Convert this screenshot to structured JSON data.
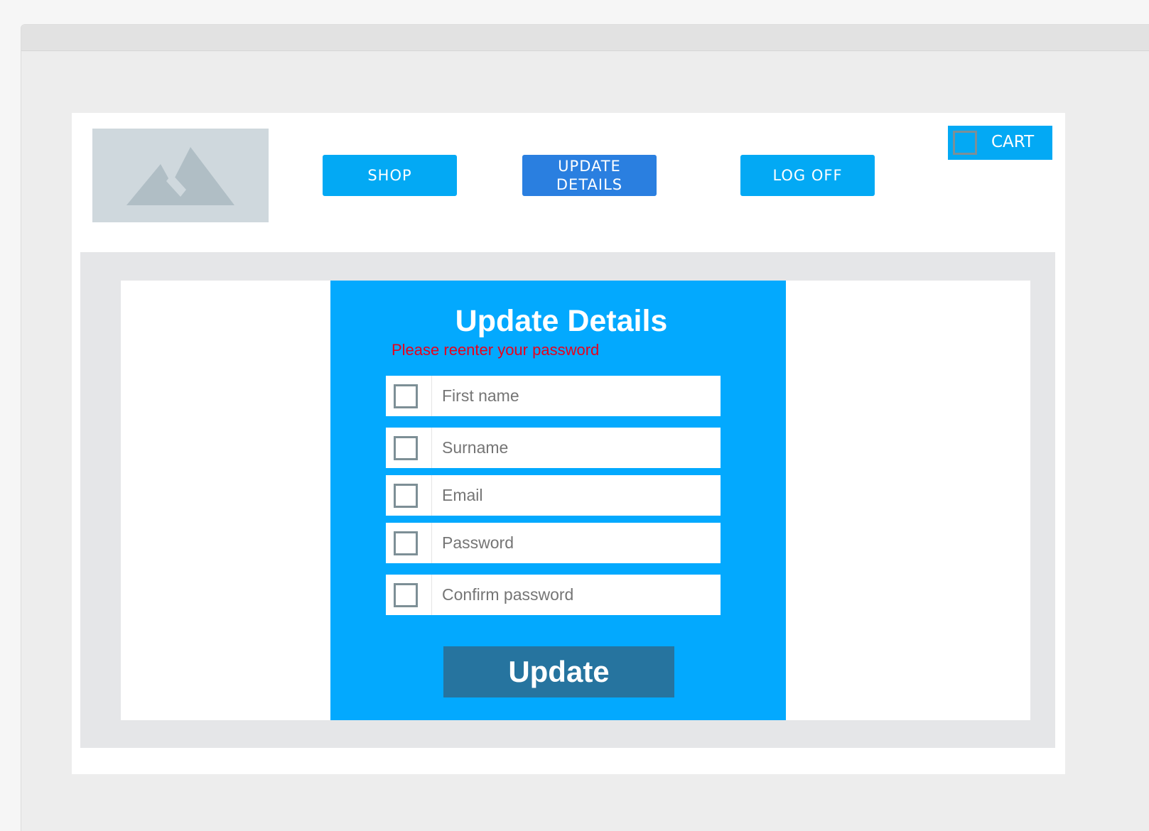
{
  "header": {
    "logo_icon": "image-placeholder-icon",
    "nav": {
      "shop_label": "SHOP",
      "update_details_label": "UPDATE DETAILS",
      "log_off_label": "LOG OFF"
    },
    "cart": {
      "icon": "cart-icon",
      "label": "CART"
    }
  },
  "form": {
    "title": "Update Details",
    "error_message": "Please reenter your password",
    "fields": [
      {
        "placeholder": "First name",
        "value": ""
      },
      {
        "placeholder": "Surname",
        "value": ""
      },
      {
        "placeholder": "Email",
        "value": ""
      },
      {
        "placeholder": "Password",
        "value": ""
      },
      {
        "placeholder": "Confirm password",
        "value": ""
      }
    ],
    "submit_label": "Update"
  },
  "colors": {
    "primary": "#03a9f4",
    "active_nav": "#2a7fe0",
    "submit_button": "#26749f",
    "error_text": "#e8001c",
    "panel_background": "#e5e6e8"
  }
}
